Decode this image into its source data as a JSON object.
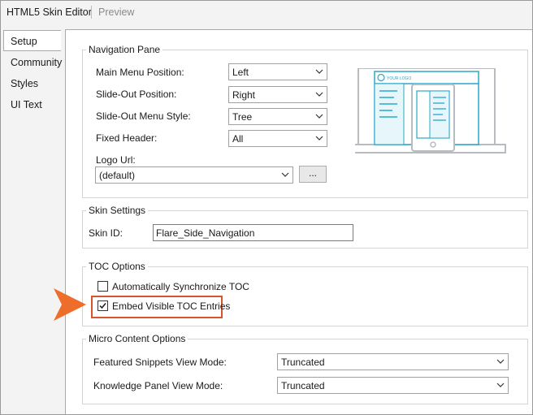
{
  "tabs": {
    "editor": "HTML5 Skin Editor",
    "preview": "Preview"
  },
  "sidebar": {
    "items": [
      "Setup",
      "Community",
      "Styles",
      "UI Text"
    ],
    "active": "Setup"
  },
  "navigation_pane": {
    "legend": "Navigation Pane",
    "main_menu_position": {
      "label": "Main Menu Position:",
      "value": "Left"
    },
    "slide_out_position": {
      "label": "Slide-Out Position:",
      "value": "Right"
    },
    "slide_out_menu_style": {
      "label": "Slide-Out Menu Style:",
      "value": "Tree"
    },
    "fixed_header": {
      "label": "Fixed Header:",
      "value": "All"
    },
    "logo_url": {
      "label": "Logo Url:",
      "value": "(default)",
      "browse_label": "..."
    },
    "preview_logo_text": "YOUR LOGO"
  },
  "skin_settings": {
    "legend": "Skin Settings",
    "skin_id": {
      "label": "Skin ID:",
      "value": "Flare_Side_Navigation"
    }
  },
  "toc_options": {
    "legend": "TOC Options",
    "auto_sync": {
      "label": "Automatically Synchronize TOC",
      "checked": false
    },
    "embed_visible": {
      "label": "Embed Visible TOC Entries",
      "checked": true
    }
  },
  "micro_content": {
    "legend": "Micro Content Options",
    "featured_snippets": {
      "label": "Featured Snippets View Mode:",
      "value": "Truncated"
    },
    "knowledge_panel": {
      "label": "Knowledge Panel View Mode:",
      "value": "Truncated"
    }
  },
  "colors": {
    "highlight": "#d9542b",
    "arrow": "#ef6d2a",
    "illustration_accent": "#2aa7c8",
    "illustration_gray": "#b8bcc0"
  }
}
